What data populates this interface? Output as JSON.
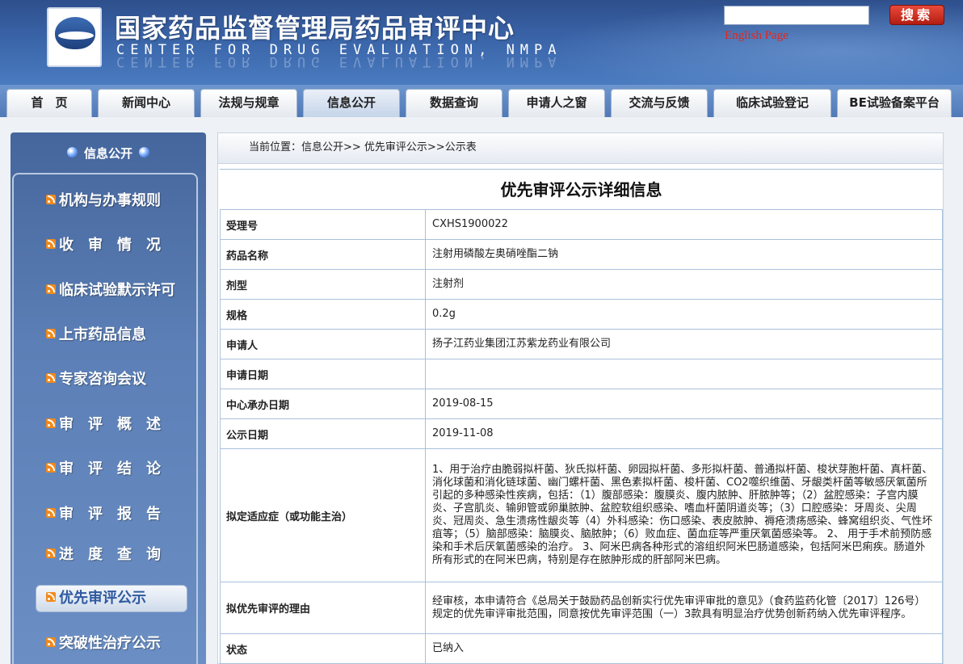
{
  "header": {
    "title": "国家药品监督管理局药品审评中心",
    "subtitle": "CENTER FOR DRUG EVALUATION, NMPA",
    "logo_text": "NMPA CDE",
    "search": {
      "value": "",
      "button_label": "搜索"
    },
    "english_link": "English Page"
  },
  "nav": {
    "tabs": [
      {
        "label": "首　页"
      },
      {
        "label": "新闻中心"
      },
      {
        "label": "法规与规章"
      },
      {
        "label": "信息公开"
      },
      {
        "label": "数据查询"
      },
      {
        "label": "申请人之窗"
      },
      {
        "label": "交流与反馈"
      },
      {
        "label": "临床试验登记"
      },
      {
        "label": "BE试验备案平台"
      }
    ],
    "active": "信息公开"
  },
  "sidebar": {
    "title": "信息公开",
    "items": [
      {
        "label": "机构与办事规则"
      },
      {
        "label": "收　审　情　况"
      },
      {
        "label": "临床试验默示许可"
      },
      {
        "label": "上市药品信息"
      },
      {
        "label": "专家咨询会议"
      },
      {
        "label": "审　评　概　述"
      },
      {
        "label": "审　评　结　论"
      },
      {
        "label": "审　评　报　告"
      },
      {
        "label": "进　度　查　询"
      },
      {
        "label": "优先审评公示"
      },
      {
        "label": "突破性治疗公示"
      }
    ],
    "active": "优先审评公示"
  },
  "main": {
    "breadcrumb": "当前位置：信息公开>> 优先审评公示>>公示表",
    "title": "优先审评公示详细信息",
    "rows": [
      {
        "key": "受理号",
        "value": "CXHS1900022"
      },
      {
        "key": "药品名称",
        "value": "注射用磷酸左奥硝唑酯二钠"
      },
      {
        "key": "剂型",
        "value": "注射剂"
      },
      {
        "key": "规格",
        "value": "0.2g"
      },
      {
        "key": "申请人",
        "value": "扬子江药业集团江苏紫龙药业有限公司"
      },
      {
        "key": "申请日期",
        "value": ""
      },
      {
        "key": "中心承办日期",
        "value": "2019-08-15"
      },
      {
        "key": "公示日期",
        "value": "2019-11-08"
      },
      {
        "key": "拟定适应症（或功能主治）",
        "value": "1、用于治疗由脆弱拟杆菌、狄氏拟杆菌、卵园拟杆菌、多形拟杆菌、普通拟杆菌、梭状芽胞杆菌、真杆菌、消化球菌和消化链球菌、幽门螺杆菌、黑色素拟杆菌、梭杆菌、CO2噬织维菌、牙龈类杆菌等敏感厌氧菌所引起的多种感染性疾病，包括：（1）腹部感染：腹膜炎、腹内脓肿、肝脓肿等；（2）盆腔感染：子宫内膜炎、子宫肌炎、输卵管或卵巢脓肿、盆腔软组织感染、嗜血杆菌阴道炎等；（3）口腔感染：牙周炎、尖周炎、冠周炎、急生溃疡性龈炎等（4）外科感染：伤口感染、表皮脓肿、褥疮溃疡感染、蜂窝组织炎、气性坏疽等；（5）脑部感染：脑膜炎、脑脓肿；（6）败血症、菌血症等严重厌氧菌感染等。 2、 用于手术前预防感染和手术后厌氧菌感染的治疗。 3、阿米巴病各种形式的溶组织阿米巴肠道感染，包括阿米巴痢疾。肠道外所有形式的在阿米巴病，特别是存在脓肿形成的肝部阿米巴病。"
      },
      {
        "key": "拟优先审评的理由",
        "value": "经审核，本申请符合《总局关于鼓励药品创新实行优先审评审批的意见》（食药监药化管〔2017〕126号）规定的优先审评审批范围，同意按优先审评范围（一）3款具有明显治疗优势创新药纳入优先审评程序。"
      },
      {
        "key": "状态",
        "value": "已纳入"
      }
    ]
  }
}
